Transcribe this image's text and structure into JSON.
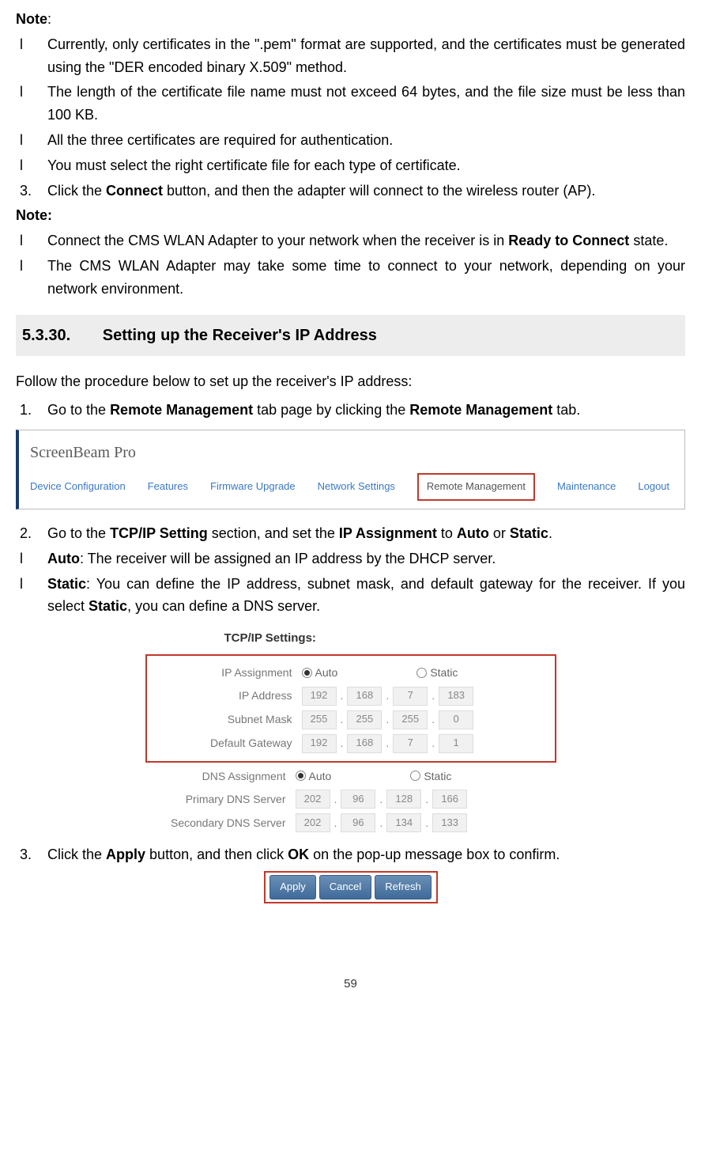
{
  "note1_label": "Note",
  "note1_colon": ":",
  "bullets1": [
    "Currently, only certificates in the \".pem\" format are supported, and the certificates must be generated using the \"DER encoded binary X.509\" method.",
    "The length of the certificate file name must not exceed 64 bytes, and the file size must be less than 100 KB.",
    "All the three certificates are required for authentication.",
    "You must select the right certificate file for each type of certificate."
  ],
  "step3": {
    "num": "3.",
    "pre": "Click the ",
    "bold1": "Connect",
    "post": " button, and then the adapter will connect to the wireless router (AP)."
  },
  "note2_label": "Note:",
  "bullets2_item1": {
    "pre": "Connect the CMS WLAN Adapter to your network when the receiver is in ",
    "bold1": "Ready to Connect",
    "post": " state."
  },
  "bullets2_item2": "The CMS WLAN Adapter may take some time to connect to your network, depending on your network environment.",
  "section": {
    "num": "5.3.30.",
    "title": "Setting up the Receiver's IP Address"
  },
  "intro": "Follow the procedure below to set up the receiver's IP address:",
  "step1": {
    "num": "1.",
    "pre": "Go to the ",
    "bold1": "Remote Management",
    "mid": " tab page by clicking the ",
    "bold2": "Remote Management",
    "post": " tab."
  },
  "ss1": {
    "title": "ScreenBeam Pro",
    "tabs": [
      "Device Configuration",
      "Features",
      "Firmware Upgrade",
      "Network Settings",
      "Remote Management",
      "Maintenance",
      "Logout"
    ],
    "active_index": 4
  },
  "step2": {
    "num": "2.",
    "pre": "Go to the ",
    "bold1": "TCP/IP Setting",
    "mid1": " section, and set the ",
    "bold2": "IP Assignment",
    "mid2": " to ",
    "bold3": "Auto",
    "mid3": " or ",
    "bold4": "Static",
    "post": "."
  },
  "auto_line": {
    "bold": "Auto",
    "text": ": The receiver will be assigned an IP address by the DHCP server."
  },
  "static_line": {
    "bold1": "Static",
    "text1": ": You can define the IP address, subnet mask, and default gateway for the receiver. If you select ",
    "bold2": "Static",
    "text2": ", you can define a DNS server."
  },
  "ss2": {
    "heading": "TCP/IP Settings:",
    "labels": {
      "ip_assign": "IP Assignment",
      "ip_addr": "IP Address",
      "subnet": "Subnet Mask",
      "gateway": "Default Gateway",
      "dns_assign": "DNS Assignment",
      "dns1": "Primary DNS Server",
      "dns2": "Secondary DNS Server"
    },
    "radio_auto": "Auto",
    "radio_static": "Static",
    "ip": [
      "192",
      "168",
      "7",
      "183"
    ],
    "sm": [
      "255",
      "255",
      "255",
      "0"
    ],
    "gw": [
      "192",
      "168",
      "7",
      "1"
    ],
    "d1": [
      "202",
      "96",
      "128",
      "166"
    ],
    "d2": [
      "202",
      "96",
      "134",
      "133"
    ]
  },
  "step3b": {
    "num": "3.",
    "pre": "Click the ",
    "bold1": "Apply",
    "mid": " button, and then click ",
    "bold2": "OK",
    "post": " on the pop-up message box to confirm."
  },
  "buttons": [
    "Apply",
    "Cancel",
    "Refresh"
  ],
  "page_number": "59",
  "bullet_char": "l"
}
